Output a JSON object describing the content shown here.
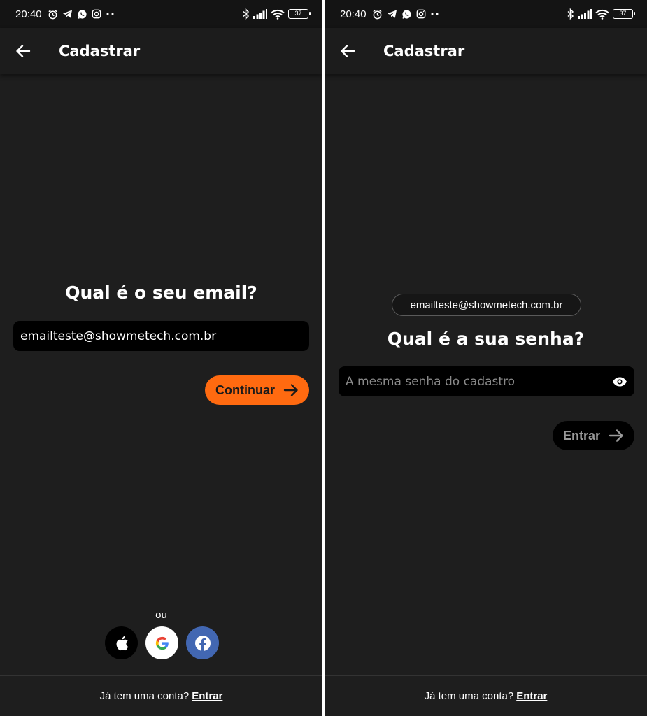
{
  "left": {
    "status_bar": {
      "time": "20:40",
      "battery": "37"
    },
    "app_bar": {
      "title": "Cadastrar"
    },
    "question": "Qual é o seu email?",
    "email_field": {
      "value": "emailteste@showmetech.com.br"
    },
    "continue_button": {
      "label": "Continuar"
    },
    "divider_label": "ou",
    "social": {
      "apple": "apple-icon",
      "google": "google-icon",
      "facebook": "facebook-icon"
    },
    "footer": {
      "text": "Já tem uma conta?",
      "link": "Entrar"
    }
  },
  "right": {
    "status_bar": {
      "time": "20:40",
      "battery": "37"
    },
    "app_bar": {
      "title": "Cadastrar"
    },
    "email_chip": "emailteste@showmetech.com.br",
    "question": "Qual é a sua senha?",
    "password_field": {
      "placeholder": "A mesma senha do cadastro"
    },
    "enter_button": {
      "label": "Entrar"
    },
    "footer": {
      "text": "Já tem uma conta?",
      "link": "Entrar"
    }
  },
  "colors": {
    "background": "#1e1e1e",
    "accent": "#ff6a10",
    "facebook": "#4267b2"
  }
}
